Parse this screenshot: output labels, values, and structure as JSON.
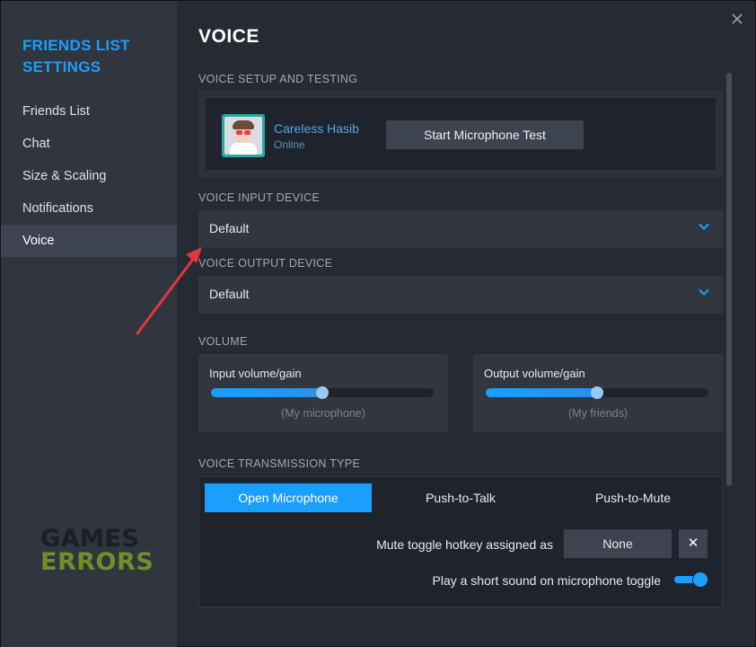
{
  "sidebar": {
    "title": "FRIENDS LIST SETTINGS",
    "items": [
      {
        "label": "Friends List"
      },
      {
        "label": "Chat"
      },
      {
        "label": "Size & Scaling"
      },
      {
        "label": "Notifications"
      },
      {
        "label": "Voice",
        "active": true
      }
    ]
  },
  "watermark": {
    "line1": "GAMES",
    "line2": "ERRORS"
  },
  "page": {
    "title": "VOICE"
  },
  "setup": {
    "section_label": "VOICE SETUP AND TESTING",
    "user_name": "Careless Hasib",
    "user_status": "Online",
    "mic_test_label": "Start Microphone Test"
  },
  "input_device": {
    "section_label": "VOICE INPUT DEVICE",
    "value": "Default"
  },
  "output_device": {
    "section_label": "VOICE OUTPUT DEVICE",
    "value": "Default"
  },
  "volume": {
    "section_label": "VOLUME",
    "input": {
      "label": "Input volume/gain",
      "sub": "(My microphone)",
      "level": 0.5
    },
    "output": {
      "label": "Output volume/gain",
      "sub": "(My friends)",
      "level": 0.5
    }
  },
  "transmission": {
    "section_label": "VOICE TRANSMISSION TYPE",
    "tabs": [
      {
        "label": "Open Microphone",
        "active": true
      },
      {
        "label": "Push-to-Talk",
        "active": false
      },
      {
        "label": "Push-to-Mute",
        "active": false
      }
    ],
    "hotkey_label": "Mute toggle hotkey assigned as",
    "hotkey_value": "None",
    "clear_symbol": "✕",
    "sound_label": "Play a short sound on microphone toggle",
    "sound_enabled": true
  },
  "colors": {
    "accent": "#1a9fff",
    "annotation_arrow": "#e0383e"
  }
}
